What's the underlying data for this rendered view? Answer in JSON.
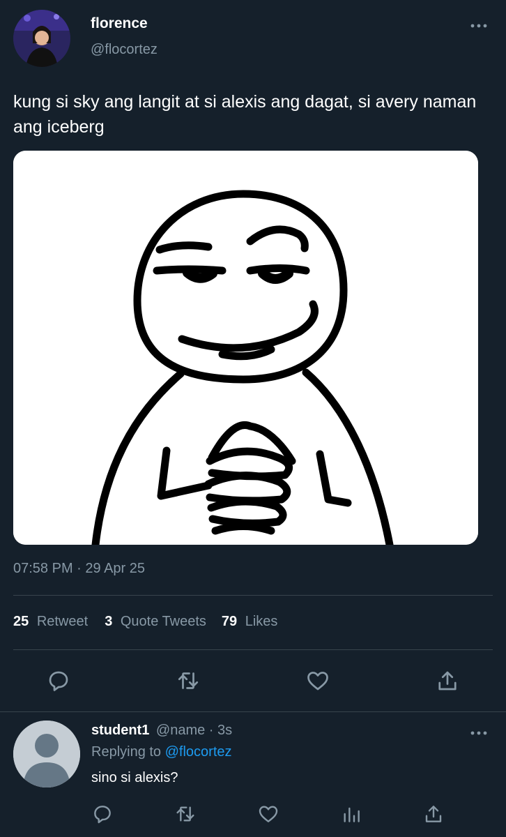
{
  "tweet": {
    "author_name": "florence",
    "author_handle": "@flocortez",
    "text": "kung si sky ang langit at si alexis ang dagat, si avery naman ang iceberg",
    "timestamp": "07:58 PM · 29 Apr 25",
    "media_description_icon": "smug-meme-face",
    "stats": {
      "retweets_count": "25",
      "retweets_label": "Retweet",
      "quotes_count": "3",
      "quotes_label": "Quote Tweets",
      "likes_count": "79",
      "likes_label": "Likes"
    },
    "actions": [
      "reply-icon",
      "retweet-icon",
      "like-icon",
      "share-icon"
    ]
  },
  "reply": {
    "name": "student1",
    "meta": "@name · 3s",
    "replying_prefix": "Replying to",
    "replying_handle": "@flocortez",
    "text": "sino si alexis?",
    "actions": [
      "reply-icon",
      "retweet-icon",
      "like-icon",
      "analytics-icon",
      "share-icon"
    ]
  },
  "colors": {
    "background": "#15202b",
    "secondary_text": "#8899a6",
    "divider": "#38444d",
    "link": "#1d9bf0"
  }
}
